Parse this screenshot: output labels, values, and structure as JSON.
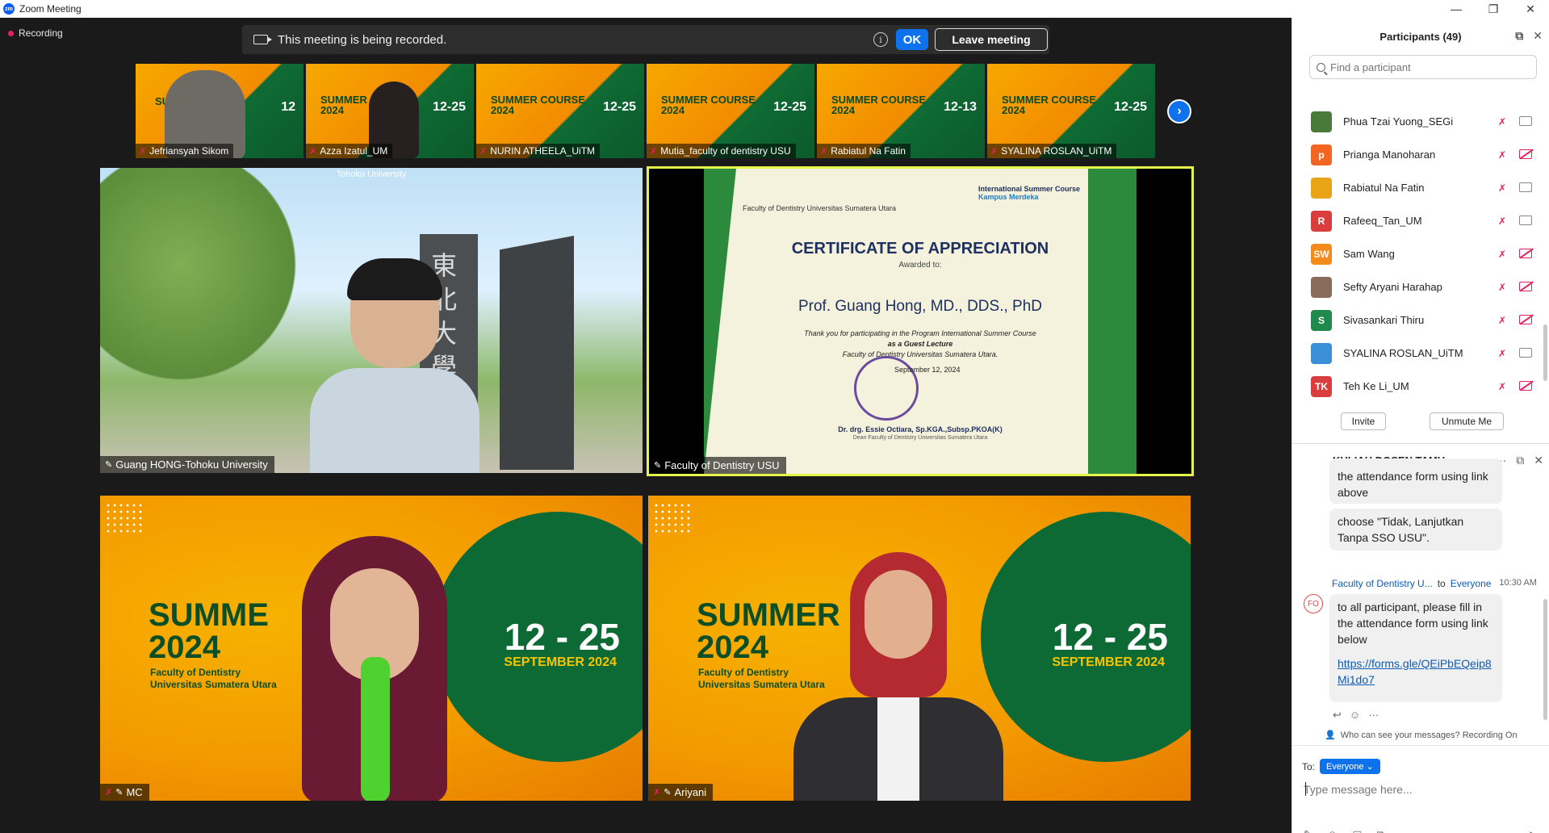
{
  "window": {
    "title": "Zoom Meeting",
    "controls": [
      "—",
      "❐",
      "✕"
    ]
  },
  "meeting": {
    "recording_label": "Recording",
    "banner": {
      "message": "This meeting is being recorded.",
      "info": "i",
      "ok": "OK",
      "leave": "Leave meeting"
    },
    "next_arrow": "›",
    "thumbnails": [
      {
        "name": "Jefriansyah Sikom",
        "dates": "12",
        "summer": "SUMMER CO",
        "kind": "person-video"
      },
      {
        "name": "Azza Izatul_UM",
        "dates": "12-25",
        "summer": "SUMMER\n2024",
        "kind": "person-bg"
      },
      {
        "name": "NURIN ATHEELA_UiTM",
        "dates": "12-25",
        "summer": "SUMMER COURSE\n2024",
        "kind": "bg"
      },
      {
        "name": "Mutia_faculty of dentistry USU",
        "dates": "12-25",
        "summer": "SUMMER COURSE\n2024",
        "kind": "bg"
      },
      {
        "name": "Rabiatul Na Fatin",
        "dates": "12-13",
        "summer": "SUMMER COURSE\n2024",
        "kind": "bg"
      },
      {
        "name": "SYALINA ROSLAN_UiTM",
        "dates": "12-25",
        "summer": "SUMMER COURSE\n2024",
        "kind": "bg"
      }
    ],
    "tiles": {
      "t1": {
        "name": "Guang HONG-Tohoku University",
        "watermark": "Tohoku University"
      },
      "t2": {
        "name": "Faculty of Dentistry USU"
      },
      "t3": {
        "name": "MC",
        "summer": "SUMME",
        "year": "2024",
        "fac1": "Faculty of Dentistry",
        "fac2": "Universitas Sumatera Utara",
        "dates": "12 - 25",
        "sept": "SEPTEMBER 2024"
      },
      "t4": {
        "name": "Ariyani",
        "summer": "SUMMER CO",
        "year": "2024",
        "fac1": "Faculty of Dentistry",
        "fac2": "Universitas Sumatera Utara",
        "dates": "12 - 25",
        "sept": "SEPTEMBER 2024"
      }
    },
    "certificate": {
      "org": "Faculty of Dentistry Universitas Sumatera Utara",
      "logo_right": "International Summer Course",
      "logo_right2": "Kampus Merdeka",
      "title": "CERTIFICATE OF APPRECIATION",
      "awarded": "Awarded to:",
      "recipient": "Prof. Guang Hong, MD., DDS., PhD",
      "body1": "Thank you for participating in the Program International Summer Course",
      "body2": "as a Guest Lecture",
      "body3": "Faculty of Dentistry Universitas Sumatera Utara.",
      "date": "September 12, 2024",
      "signer": "Dr. drg. Essie Octiara, Sp.KGA.,Subsp.PKOA(K)",
      "dean": "Dean Faculty of Dentistry Universitas Sumatera Utara"
    }
  },
  "participants": {
    "title": "Participants (49)",
    "search_placeholder": "Find a participant",
    "items": [
      {
        "name": "Phua Tzai Yuong_SEGi",
        "initials": "",
        "color": "#4a7a3a",
        "cam_off": false
      },
      {
        "name": "Prianga Manoharan",
        "initials": "p",
        "color": "#f26522",
        "cam_off": true
      },
      {
        "name": "Rabiatul Na Fatin",
        "initials": "",
        "color": "#e8a317",
        "cam_off": false
      },
      {
        "name": "Rafeeq_Tan_UM",
        "initials": "R",
        "color": "#d93d3d",
        "cam_off": false
      },
      {
        "name": "Sam Wang",
        "initials": "SW",
        "color": "#f28a1c",
        "cam_off": true
      },
      {
        "name": "Sefty Aryani Harahap",
        "initials": "",
        "color": "#8a6b5a",
        "cam_off": true
      },
      {
        "name": "Sivasankari Thiru",
        "initials": "S",
        "color": "#1f8a4c",
        "cam_off": true
      },
      {
        "name": "SYALINA ROSLAN_UiTM",
        "initials": "",
        "color": "#3a8fd6",
        "cam_off": false
      },
      {
        "name": "Teh Ke Li_UM",
        "initials": "TK",
        "color": "#d93d3d",
        "cam_off": true
      }
    ],
    "invite": "Invite",
    "unmute": "Unmute Me"
  },
  "chat": {
    "title": "KULIAH DOSEN TAMU",
    "messages": [
      {
        "text": "the attendance form using link above"
      },
      {
        "text": "choose \"Tidak, Lanjutkan Tanpa SSO USU\"."
      }
    ],
    "last": {
      "sender": "Faculty of Dentistry U...",
      "to_word": "to",
      "to": "Everyone",
      "time": "10:30 AM",
      "avatar": "FO",
      "text": "to all participant, please fill in the attendance form using link below",
      "link": "https://forms.gle/QEiPbEQeip8Mi1do7"
    },
    "visibility": "Who can see your messages? Recording On",
    "to_label": "To:",
    "to_value": "Everyone ⌄",
    "placeholder": "Type message here..."
  }
}
